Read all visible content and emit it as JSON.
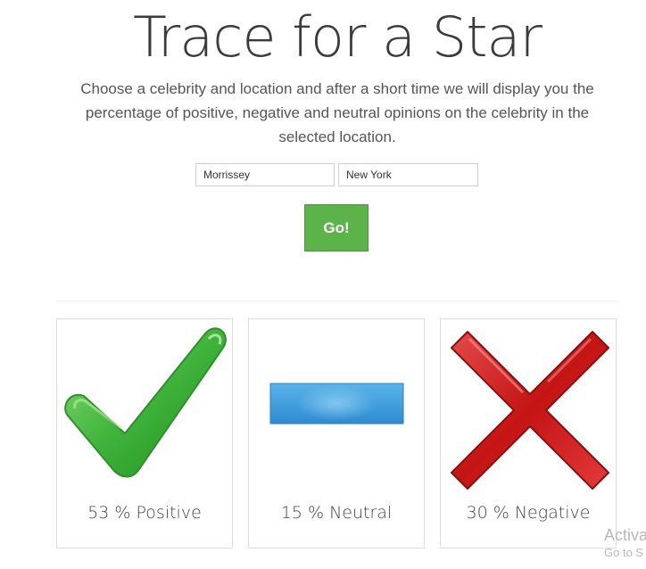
{
  "header": {
    "title": "Trace for a Star",
    "description": "Choose a celebrity and location and after a short time we will display you the percentage of positive, negative and neutral opinions on the celebrity in the selected location."
  },
  "form": {
    "celebrity_value": "Morrissey",
    "location_value": "New York",
    "go_label": "Go!",
    "go_color": "#5cb349"
  },
  "results": {
    "positive": {
      "label": "53 % Positive",
      "percent": 53,
      "icon": "checkmark-icon",
      "color": "#3fae3b"
    },
    "neutral": {
      "label": "15 % Neutral",
      "percent": 15,
      "icon": "minus-icon",
      "color": "#3d9ad8"
    },
    "negative": {
      "label": "30 % Negative",
      "percent": 30,
      "icon": "cross-icon",
      "color": "#c81e1e"
    }
  },
  "watermark": {
    "line1": "Activa",
    "line2": "Go to S"
  }
}
